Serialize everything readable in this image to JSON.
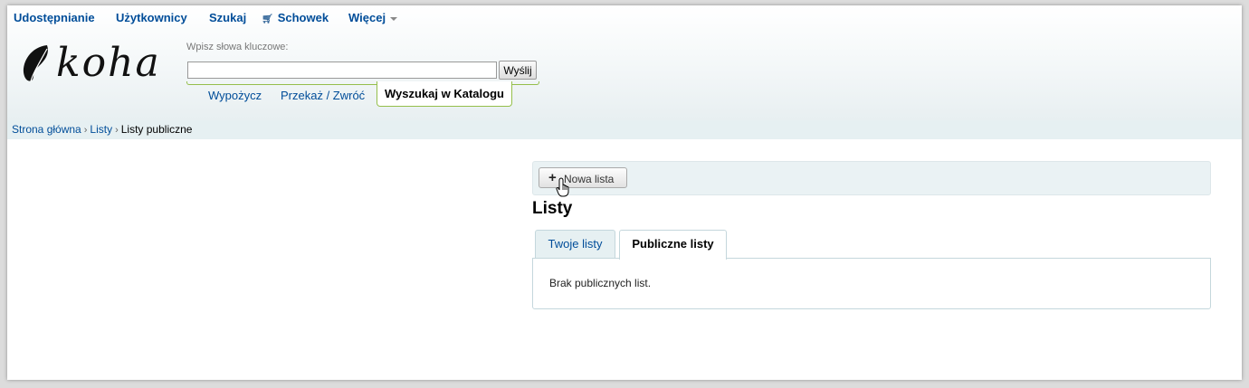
{
  "topnav": {
    "items": [
      {
        "label": "Udostępnianie"
      },
      {
        "label": "Użytkownicy"
      },
      {
        "label": "Szukaj"
      },
      {
        "label": "Schowek"
      },
      {
        "label": "Więcej"
      }
    ]
  },
  "logo": {
    "text": "koha"
  },
  "search": {
    "label": "Wpisz słowa kluczowe:",
    "value": "",
    "submit_label": "Wyślij",
    "tabs": [
      {
        "label": "Wypożycz"
      },
      {
        "label": "Przekaż / Zwróć"
      },
      {
        "label": "Wyszukaj w Katalogu",
        "active": true
      }
    ]
  },
  "breadcrumb": {
    "items": [
      {
        "label": "Strona główna"
      },
      {
        "label": "Listy"
      },
      {
        "label": "Listy publiczne"
      }
    ],
    "separator": "›"
  },
  "toolbar": {
    "new_list_label": "Nowa lista"
  },
  "main": {
    "heading": "Listy",
    "tabs": [
      {
        "label": "Twoje listy"
      },
      {
        "label": "Publiczne listy",
        "active": true
      }
    ],
    "empty_message": "Brak publicznych list."
  },
  "colors": {
    "link": "#004d99",
    "accent_green": "#95bf4b",
    "breadcrumb_bg": "#e6f0f2",
    "tab_border": "#c4d7dc"
  }
}
